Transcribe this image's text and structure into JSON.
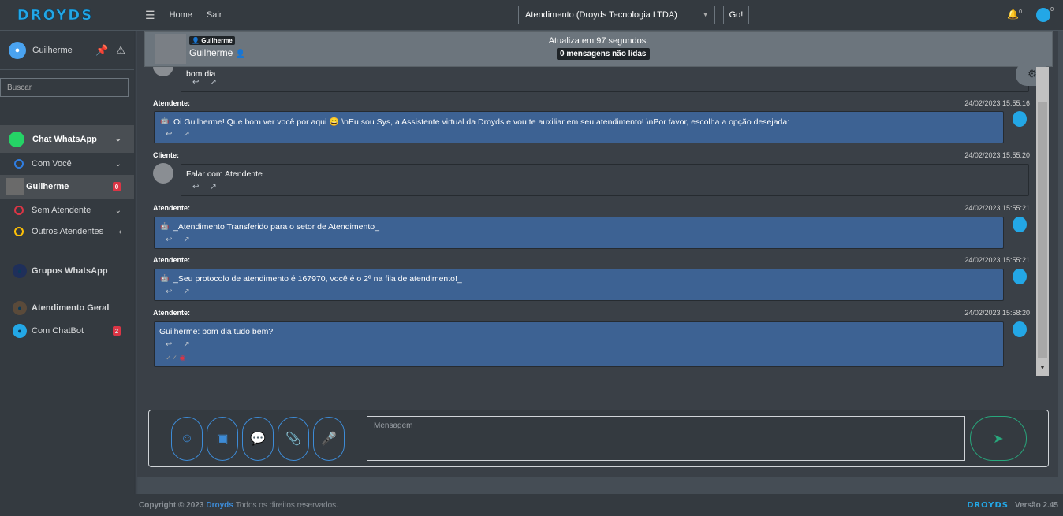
{
  "brand": {
    "logo": "DROYDS"
  },
  "user": {
    "name": "Guilherme"
  },
  "sidebar": {
    "search_placeholder": "Buscar",
    "chat_whatsapp": "Chat WhatsApp",
    "com_voce": "Com Você",
    "active_contact": "Guilherme",
    "active_badge": "0",
    "sem_atendente": "Sem Atendente",
    "outros_atendentes": "Outros Atendentes",
    "grupos": "Grupos WhatsApp",
    "atendimento_geral": "Atendimento Geral",
    "com_chatbot": "Com ChatBot",
    "chatbot_badge": "2"
  },
  "topbar": {
    "home": "Home",
    "sair": "Sair",
    "selected_queue": "Atendimento (Droyds Tecnologia LTDA)",
    "go": "Go!",
    "bell_count": "0",
    "bot_count": "0"
  },
  "chat_header": {
    "tag": "Guilherme",
    "name": "Guilherme",
    "update_text": "Atualiza em 97 segundos.",
    "unread": "0 mensagens não lidas"
  },
  "messages": [
    {
      "text": "bom dia"
    },
    {
      "label": "Atendente:",
      "time": "24/02/2023 15:55:16",
      "text": "Oi Guilherme! Que bom ver você por aqui 😄 \\nEu sou Sys, a Assistente virtual da Droyds e vou te auxiliar em seu atendimento! \\nPor favor, escolha a opção desejada:"
    },
    {
      "label": "Cliente:",
      "time": "24/02/2023 15:55:20",
      "text": "Falar com Atendente"
    },
    {
      "label": "Atendente:",
      "time": "24/02/2023 15:55:21",
      "text": "_Atendimento Transferido para o setor de Atendimento_"
    },
    {
      "label": "Atendente:",
      "time": "24/02/2023 15:55:21",
      "text": "_Seu protocolo de atendimento é 167970, você é o 2º na fila de atendimento!_"
    },
    {
      "label": "Atendente:",
      "time": "24/02/2023 15:58:20",
      "text": "Guilherme: bom dia tudo bem?"
    }
  ],
  "composer": {
    "placeholder": "Mensagem"
  },
  "footer": {
    "copyright": "Copyright © 2023",
    "brand": "Droyds",
    "rights": "Todos os direitos reservados.",
    "logo": "DROYDS",
    "version": "Versão 2.45"
  }
}
